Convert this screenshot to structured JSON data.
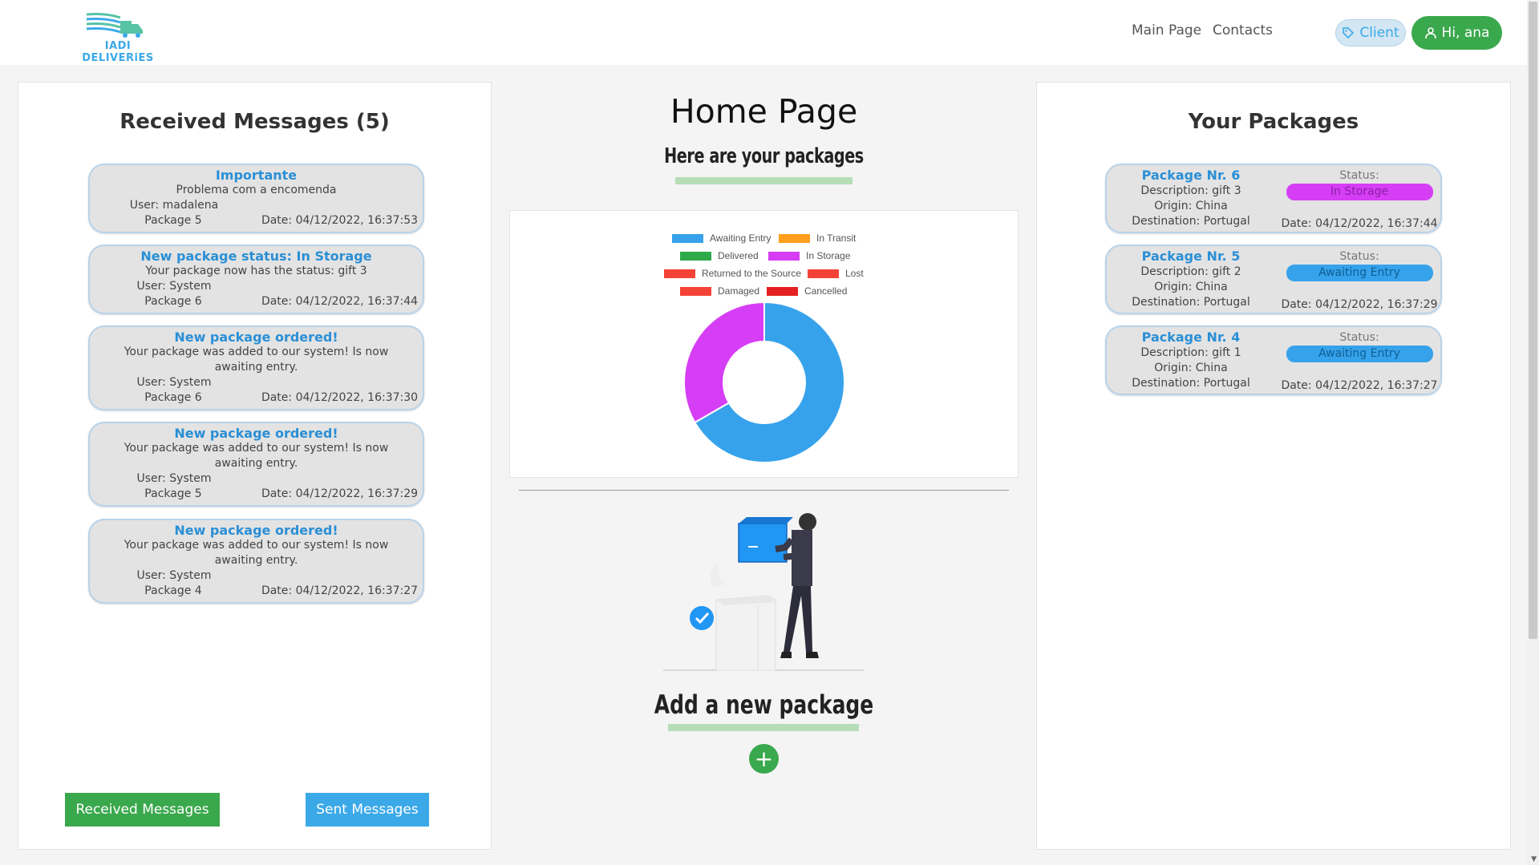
{
  "header": {
    "logo_text": "IADI DELIVERiES",
    "nav": [
      "Main Page",
      "Contacts"
    ],
    "client_label": "Client",
    "user_label": "Hi, ana"
  },
  "messages": {
    "title": "Received Messages (5)",
    "items": [
      {
        "title": "Importante",
        "body": "Problema com a encomenda",
        "user": "User: madalena",
        "package": "Package 5",
        "date": "Date: 04/12/2022, 16:37:53"
      },
      {
        "title": "New package status: In Storage",
        "body": "Your package now has the status: gift 3",
        "user": "User: System",
        "package": "Package 6",
        "date": "Date: 04/12/2022, 16:37:44"
      },
      {
        "title": "New package ordered!",
        "body": "Your package was added to our system! Is now awaiting entry.",
        "user": "User: System",
        "package": "Package 6",
        "date": "Date: 04/12/2022, 16:37:30"
      },
      {
        "title": "New package ordered!",
        "body": "Your package was added to our system! Is now awaiting entry.",
        "user": "User: System",
        "package": "Package 5",
        "date": "Date: 04/12/2022, 16:37:29"
      },
      {
        "title": "New package ordered!",
        "body": "Your package was added to our system! Is now awaiting entry.",
        "user": "User: System",
        "package": "Package 4",
        "date": "Date: 04/12/2022, 16:37:27"
      }
    ],
    "btn_received": "Received Messages",
    "btn_sent": "Sent Messages"
  },
  "center": {
    "title": "Home Page",
    "subtitle": "Here are your packages",
    "add_title": "Add a new package",
    "add_button": "+"
  },
  "chart_data": {
    "type": "pie",
    "categories": [
      "Awaiting Entry",
      "In Transit",
      "Delivered",
      "In Storage",
      "Returned to the Source",
      "Lost",
      "Damaged",
      "Cancelled"
    ],
    "values": [
      2,
      0,
      0,
      1,
      0,
      0,
      0,
      0
    ],
    "colors": [
      "#36a2eb",
      "#ff9f1c",
      "#2eaa4a",
      "#d63ef5",
      "#f44336",
      "#f44336",
      "#f44336",
      "#e52020"
    ],
    "legend": "top",
    "donut": true
  },
  "packages": {
    "title": "Your Packages",
    "items": [
      {
        "title": "Package Nr. 6",
        "description": "Description: gift 3",
        "origin": "Origin: China",
        "destination": "Destination: Portugal",
        "status_label": "Status:",
        "status": "In Storage",
        "status_color": "#d63ef5",
        "date": "Date: 04/12/2022, 16:37:44"
      },
      {
        "title": "Package Nr. 5",
        "description": "Description: gift 2",
        "origin": "Origin: China",
        "destination": "Destination: Portugal",
        "status_label": "Status:",
        "status": "Awaiting Entry",
        "status_color": "#36a2eb",
        "date": "Date: 04/12/2022, 16:37:29"
      },
      {
        "title": "Package Nr. 4",
        "description": "Description: gift 1",
        "origin": "Origin: China",
        "destination": "Destination: Portugal",
        "status_label": "Status:",
        "status": "Awaiting Entry",
        "status_color": "#36a2eb",
        "date": "Date: 04/12/2022, 16:37:27"
      }
    ]
  }
}
